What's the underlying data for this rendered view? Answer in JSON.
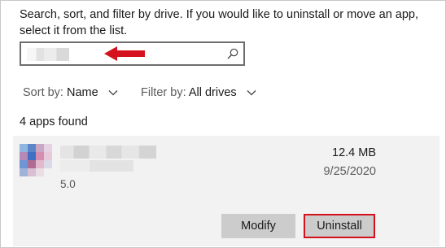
{
  "description": "Search, sort, and filter by drive. If you would like to uninstall or move an app, select it from the list.",
  "search": {
    "placeholder": "",
    "icon": "search-icon"
  },
  "sort": {
    "label": "Sort by:",
    "value": "Name"
  },
  "filter": {
    "label": "Filter by:",
    "value": "All drives"
  },
  "apps_found": "4 apps found",
  "app": {
    "version": "5.0",
    "size": "12.4 MB",
    "date": "9/25/2020",
    "modify_label": "Modify",
    "uninstall_label": "Uninstall"
  },
  "colors": {
    "highlight": "#d4111c",
    "arrow": "#d4111c",
    "card_bg": "#f2f2f2",
    "button_bg": "#cccccc"
  }
}
